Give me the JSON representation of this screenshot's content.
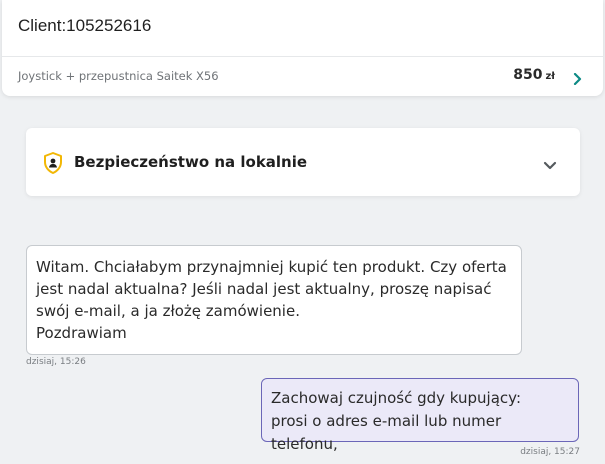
{
  "header": {
    "client_title": "Client:105252616",
    "product_name": "Joystick + przepustnica Saitek X56",
    "price": "850",
    "currency": "zł"
  },
  "safety": {
    "title": "Bezpieczeństwo na lokalnie"
  },
  "messages": [
    {
      "direction": "incoming",
      "text": "Witam. Chciałabym przynajmniej kupić ten produkt. Czy oferta\njest nadal aktualna? Jeśli nadal jest aktualny, proszę napisać\nswój e-mail, a ja złożę zamówienie.\nPozdrawiam",
      "time": "dzisiaj, 15:26"
    },
    {
      "direction": "outgoing",
      "text": "Zachowaj czujność gdy kupujący:\nprosi o adres e-mail lub numer telefonu,",
      "time": "dzisiaj, 15:27"
    }
  ],
  "colors": {
    "accent_teal": "#0d8a85",
    "shield_yellow": "#f2b705",
    "outgoing_bubble_bg": "#ebe9f8",
    "outgoing_bubble_border": "#6b66b8"
  },
  "icons": {
    "header_chevron": "chevron-right-icon",
    "safety_icon": "shield-icon",
    "safety_toggle": "chevron-down-icon"
  }
}
